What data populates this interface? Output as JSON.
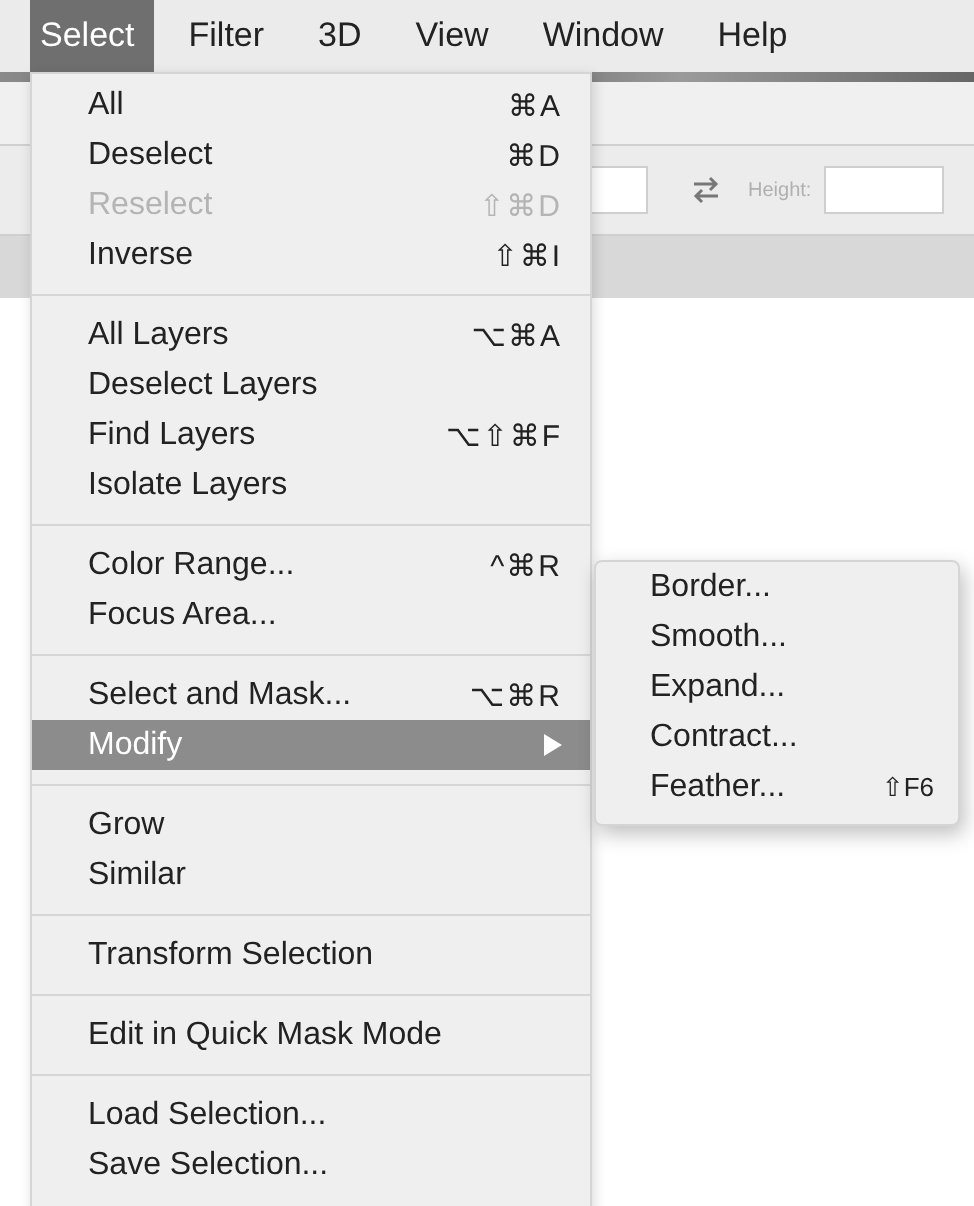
{
  "menu_bar": [
    {
      "label": "Select",
      "selected": true
    },
    {
      "label": "Filter",
      "selected": false
    },
    {
      "label": "3D",
      "selected": false
    },
    {
      "label": "View",
      "selected": false
    },
    {
      "label": "Window",
      "selected": false
    },
    {
      "label": "Help",
      "selected": false
    }
  ],
  "options_bar": {
    "height_label": "Height:"
  },
  "menu": {
    "sections": [
      [
        {
          "label": "All",
          "shortcut": "⌘A",
          "disabled": false,
          "selected": false
        },
        {
          "label": "Deselect",
          "shortcut": "⌘D",
          "disabled": false,
          "selected": false
        },
        {
          "label": "Reselect",
          "shortcut": "⇧⌘D",
          "disabled": true,
          "selected": false
        },
        {
          "label": "Inverse",
          "shortcut": "⇧⌘I",
          "disabled": false,
          "selected": false
        }
      ],
      [
        {
          "label": "All Layers",
          "shortcut": "⌥⌘A",
          "disabled": false,
          "selected": false
        },
        {
          "label": "Deselect Layers",
          "disabled": false,
          "selected": false
        },
        {
          "label": "Find Layers",
          "shortcut": "⌥⇧⌘F",
          "disabled": false,
          "selected": false
        },
        {
          "label": "Isolate Layers",
          "disabled": false,
          "selected": false
        }
      ],
      [
        {
          "label": "Color Range...",
          "shortcut": "^⌘R",
          "disabled": false,
          "selected": false
        },
        {
          "label": "Focus Area...",
          "disabled": false,
          "selected": false
        }
      ],
      [
        {
          "label": "Select and Mask...",
          "shortcut": "⌥⌘R",
          "disabled": false,
          "selected": false
        },
        {
          "label": "Modify",
          "submenu": true,
          "disabled": false,
          "selected": true
        }
      ],
      [
        {
          "label": "Grow",
          "disabled": false,
          "selected": false
        },
        {
          "label": "Similar",
          "disabled": false,
          "selected": false
        }
      ],
      [
        {
          "label": "Transform Selection",
          "disabled": false,
          "selected": false
        }
      ],
      [
        {
          "label": "Edit in Quick Mask Mode",
          "disabled": false,
          "selected": false
        }
      ],
      [
        {
          "label": "Load Selection...",
          "disabled": false,
          "selected": false
        },
        {
          "label": "Save Selection...",
          "disabled": false,
          "selected": false
        }
      ]
    ]
  },
  "submenu": {
    "items": [
      {
        "label": "Border..."
      },
      {
        "label": "Smooth..."
      },
      {
        "label": "Expand..."
      },
      {
        "label": "Contract..."
      },
      {
        "label": "Feather...",
        "shortcut": "⇧F6"
      }
    ]
  }
}
